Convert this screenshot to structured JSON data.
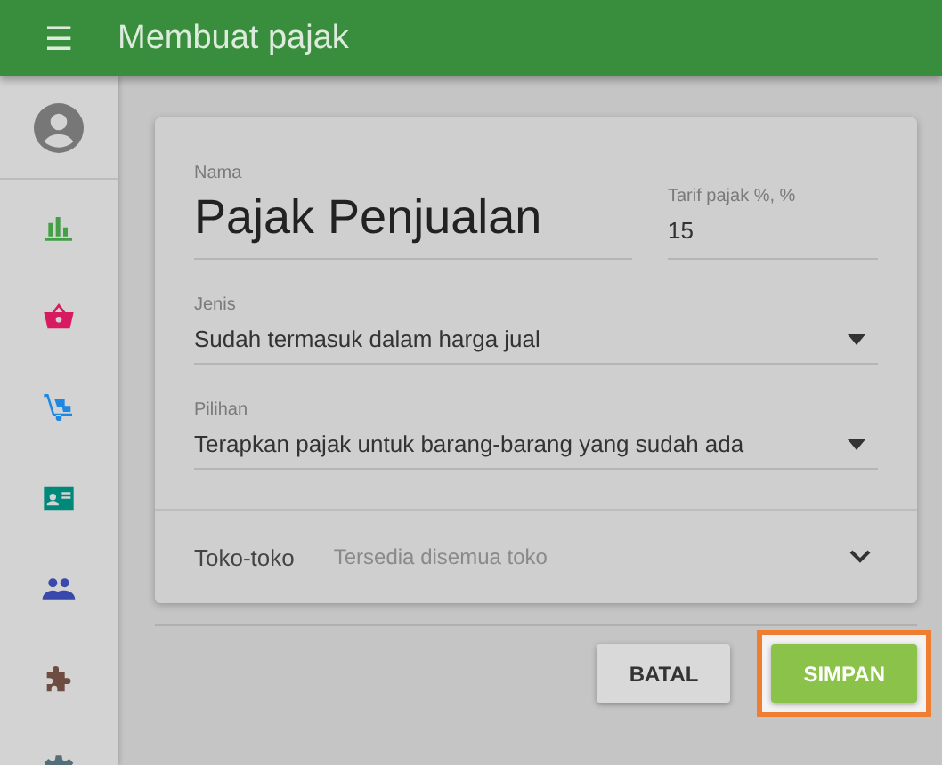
{
  "app_bar": {
    "menu_icon": "☰",
    "title": "Membuat pajak"
  },
  "sidebar": {
    "items": [
      {
        "kind": "chart",
        "color": "#43a047"
      },
      {
        "kind": "basket",
        "color": "#d81b60"
      },
      {
        "kind": "dolly",
        "color": "#1e88e5"
      },
      {
        "kind": "card",
        "color": "#00897b"
      },
      {
        "kind": "people",
        "color": "#3949ab"
      },
      {
        "kind": "puzzle",
        "color": "#6d4c41"
      },
      {
        "kind": "gear",
        "color": "#546e7a"
      }
    ]
  },
  "form": {
    "name": {
      "label": "Nama",
      "value": "Pajak Penjualan"
    },
    "rate": {
      "label": "Tarif pajak %, %",
      "value": "15"
    },
    "type": {
      "label": "Jenis",
      "value": "Sudah termasuk dalam harga jual"
    },
    "option": {
      "label": "Pilihan",
      "value": "Terapkan pajak untuk barang-barang yang sudah ada"
    },
    "stores": {
      "label": "Toko-toko",
      "value": "Tersedia disemua toko",
      "expanded": false
    }
  },
  "buttons": [
    {
      "label": "BATAL",
      "kind": "flat",
      "highlighted": false
    },
    {
      "label": "SIMPAN",
      "kind": "primary",
      "highlighted": true
    }
  ]
}
